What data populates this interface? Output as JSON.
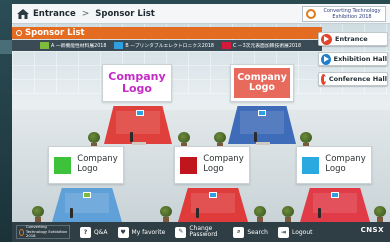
{
  "header": {
    "breadcrumb": [
      "Entrance",
      "Sponsor List"
    ],
    "separator": ">",
    "exhibition_logo_text": "Converting Technology Exhibition 2018"
  },
  "list": {
    "title": "Sponsor List",
    "categories": [
      {
        "label": "A 一新機能性材料展2018",
        "color": "#7dbb3a"
      },
      {
        "label": "B ープリンタブルエレクトロニクス2018",
        "color": "#2e9fe0"
      },
      {
        "label": "C ー3次元表面加飾技術展2018",
        "color": "#d7193c"
      }
    ]
  },
  "nav": [
    {
      "label": "Entrance",
      "color": "#e2442c"
    },
    {
      "label": "Exhibition Hall",
      "color": "#1f7fcf"
    },
    {
      "label": "Conference Hall",
      "color": "#e2442c"
    }
  ],
  "booths": [
    {
      "logo_line1": "Company",
      "logo_line2": "Logo",
      "logo_color": "#c52cc4",
      "stage_color": "#e0403b",
      "badge": "B"
    },
    {
      "logo_line1": "Company",
      "logo_line2": "Logo",
      "logo_color": "#ffffff",
      "logo_bg": "#e86a5d",
      "stage_color": "#3e6cb8",
      "badge": "B"
    },
    {
      "logo_line1": "Company",
      "logo_line2": "Logo",
      "square_color": "#3ec23b",
      "stage_color": "#5fa0d8",
      "badge": "A"
    },
    {
      "logo_line1": "Company",
      "logo_line2": "Logo",
      "square_color": "#c1151e",
      "stage_color": "#e03b3b",
      "badge": "B"
    },
    {
      "logo_line1": "Company",
      "logo_line2": "Logo",
      "square_color": "#2aa8e0",
      "stage_color": "#e03b46",
      "badge": "B"
    }
  ],
  "footer": {
    "logo_text": "Converting Technology Exhibition 2018",
    "items": [
      {
        "icon": "qa-icon",
        "label": "Q&A",
        "glyph": "?"
      },
      {
        "icon": "favorite-icon",
        "label": "My favorite",
        "glyph": "♥"
      },
      {
        "icon": "password-icon",
        "label": "Change Password",
        "glyph": "✎"
      },
      {
        "icon": "search-icon",
        "label": "Search",
        "glyph": "⌕"
      },
      {
        "icon": "logout-icon",
        "label": "Logout",
        "glyph": "⇥"
      }
    ],
    "brand": "CNSX"
  }
}
